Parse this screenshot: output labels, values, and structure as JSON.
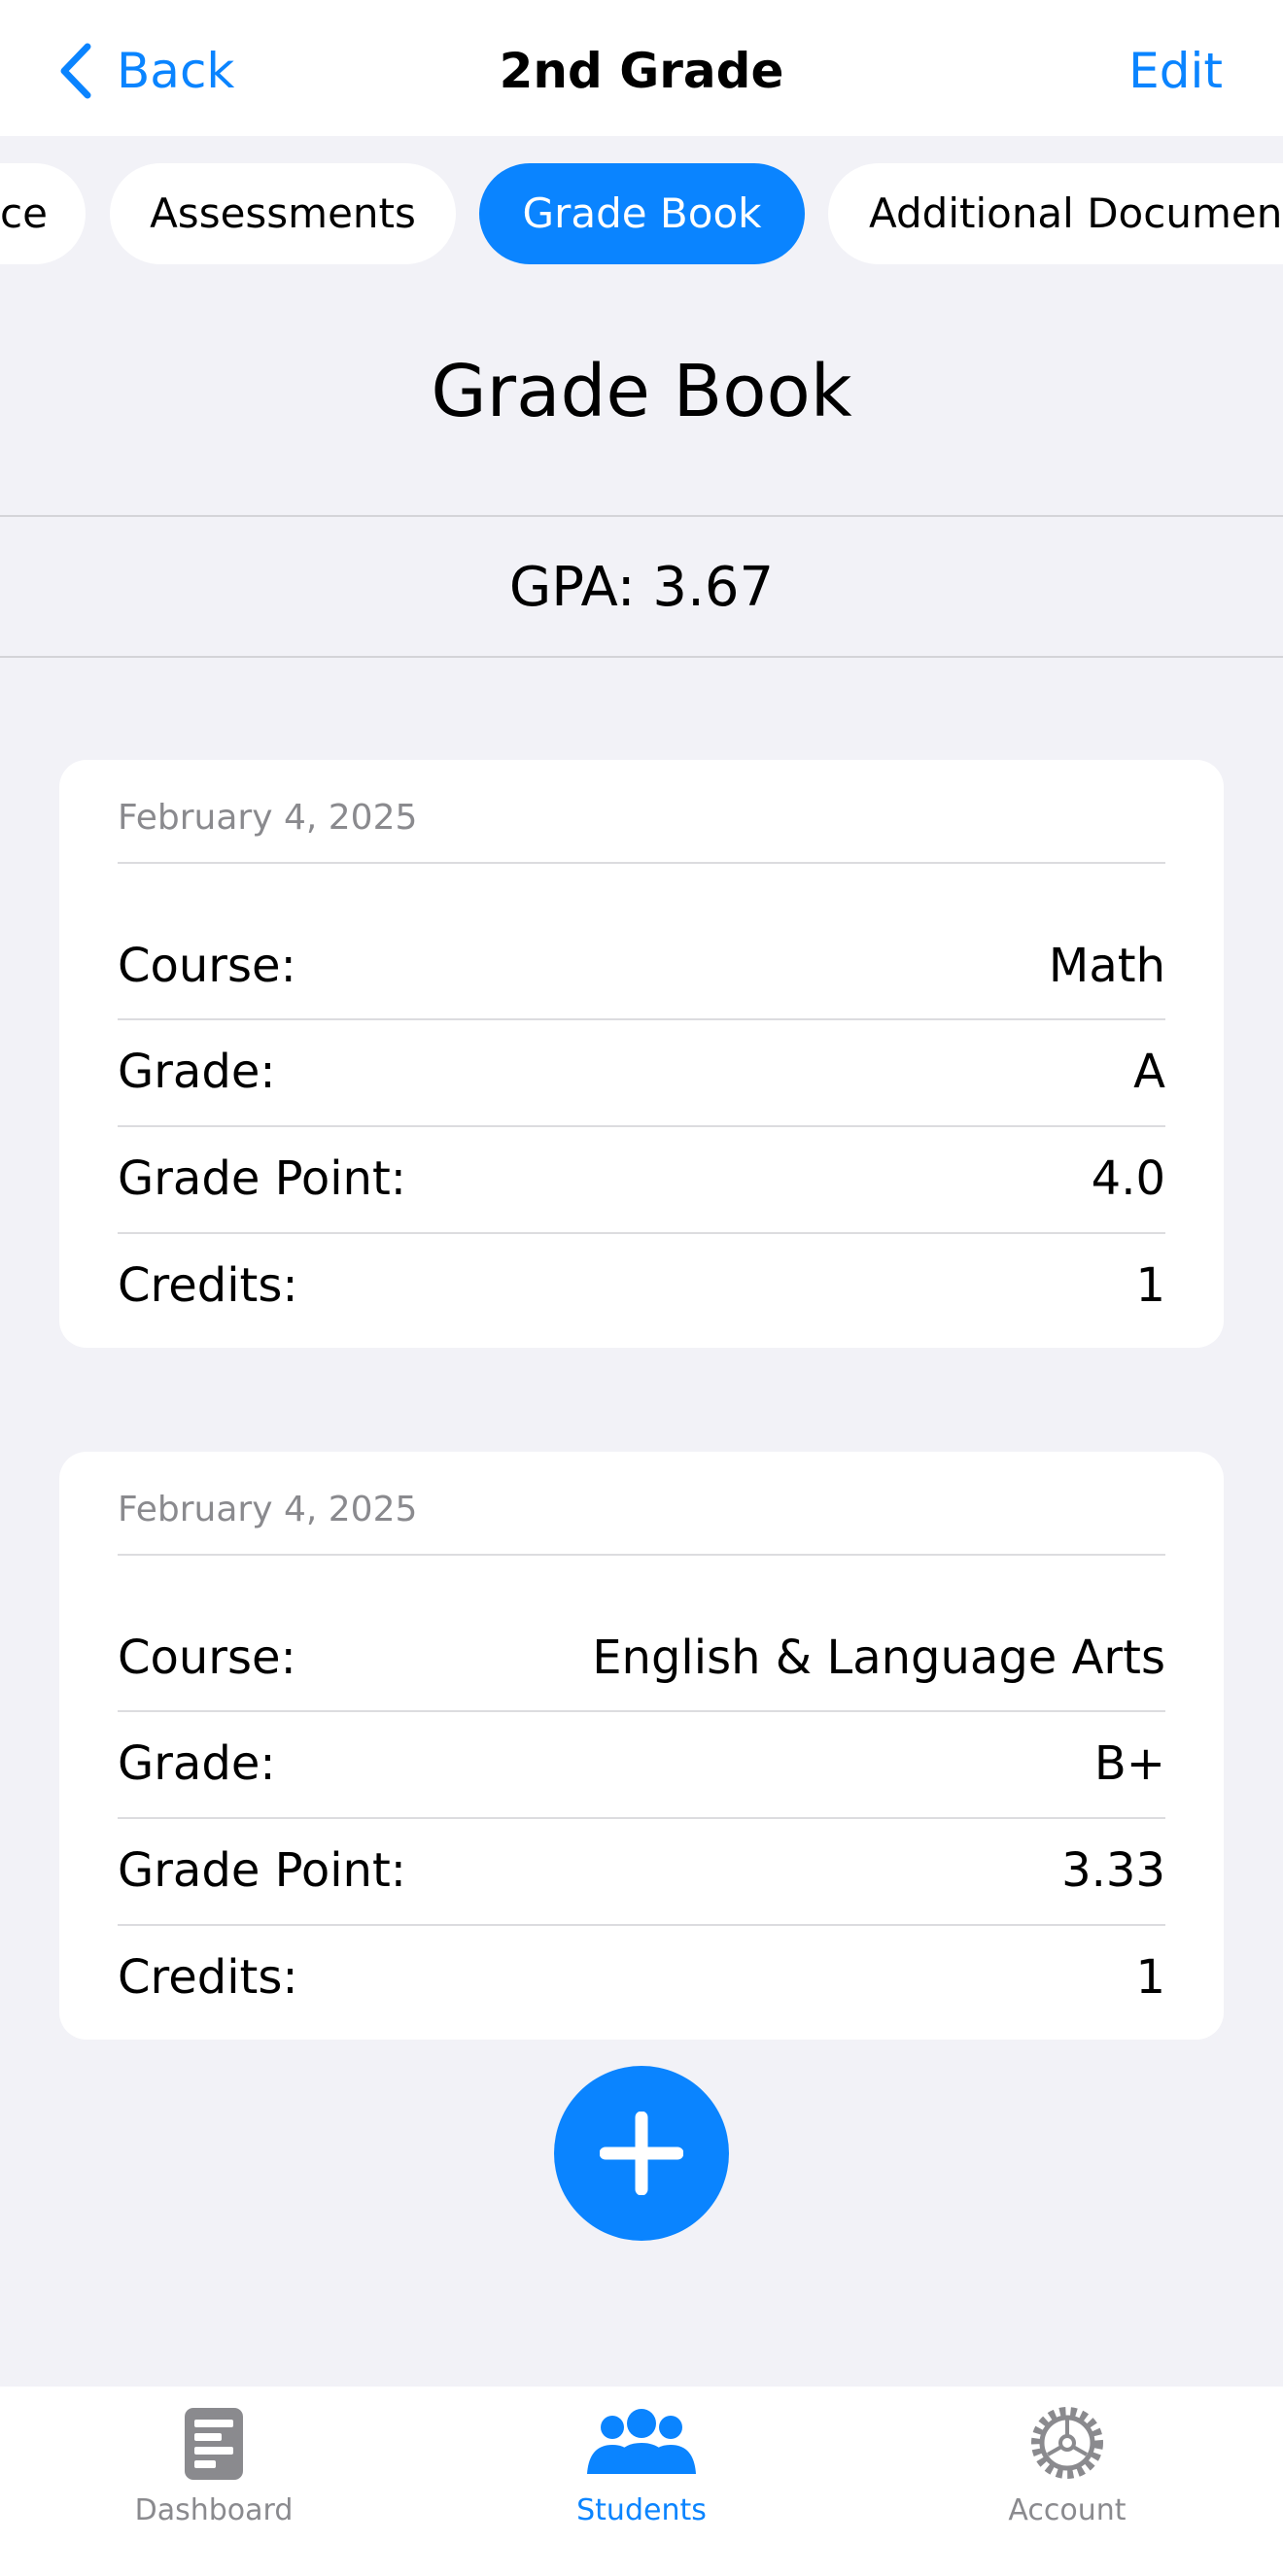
{
  "nav": {
    "back_label": "Back",
    "title": "2nd Grade",
    "edit_label": "Edit",
    "back_icon": "chevron-left-icon"
  },
  "tabs": [
    {
      "label": "ce",
      "active": false
    },
    {
      "label": "Assessments",
      "active": false
    },
    {
      "label": "Grade Book",
      "active": true
    },
    {
      "label": "Additional Documents",
      "active": false
    }
  ],
  "page": {
    "title": "Grade Book",
    "gpa_text": "GPA:  3.67"
  },
  "entries": [
    {
      "date": "February 4, 2025",
      "rows": [
        {
          "label": "Course:",
          "value": "Math"
        },
        {
          "label": "Grade:",
          "value": "A"
        },
        {
          "label": "Grade Point:",
          "value": "4.0"
        },
        {
          "label": "Credits:",
          "value": "1"
        }
      ]
    },
    {
      "date": "February 4, 2025",
      "rows": [
        {
          "label": "Course:",
          "value": "English & Language Arts"
        },
        {
          "label": "Grade:",
          "value": "B+"
        },
        {
          "label": "Grade Point:",
          "value": "3.33"
        },
        {
          "label": "Credits:",
          "value": "1"
        }
      ]
    }
  ],
  "fab_icon": "plus-icon",
  "tabbar": [
    {
      "label": "Dashboard",
      "icon": "dashboard-icon",
      "active": false
    },
    {
      "label": "Students",
      "icon": "students-icon",
      "active": true
    },
    {
      "label": "Account",
      "icon": "gear-icon",
      "active": false
    }
  ],
  "colors": {
    "accent": "#0a84ff",
    "background": "#f2f2f7",
    "secondary_text": "#8a8a8e"
  }
}
